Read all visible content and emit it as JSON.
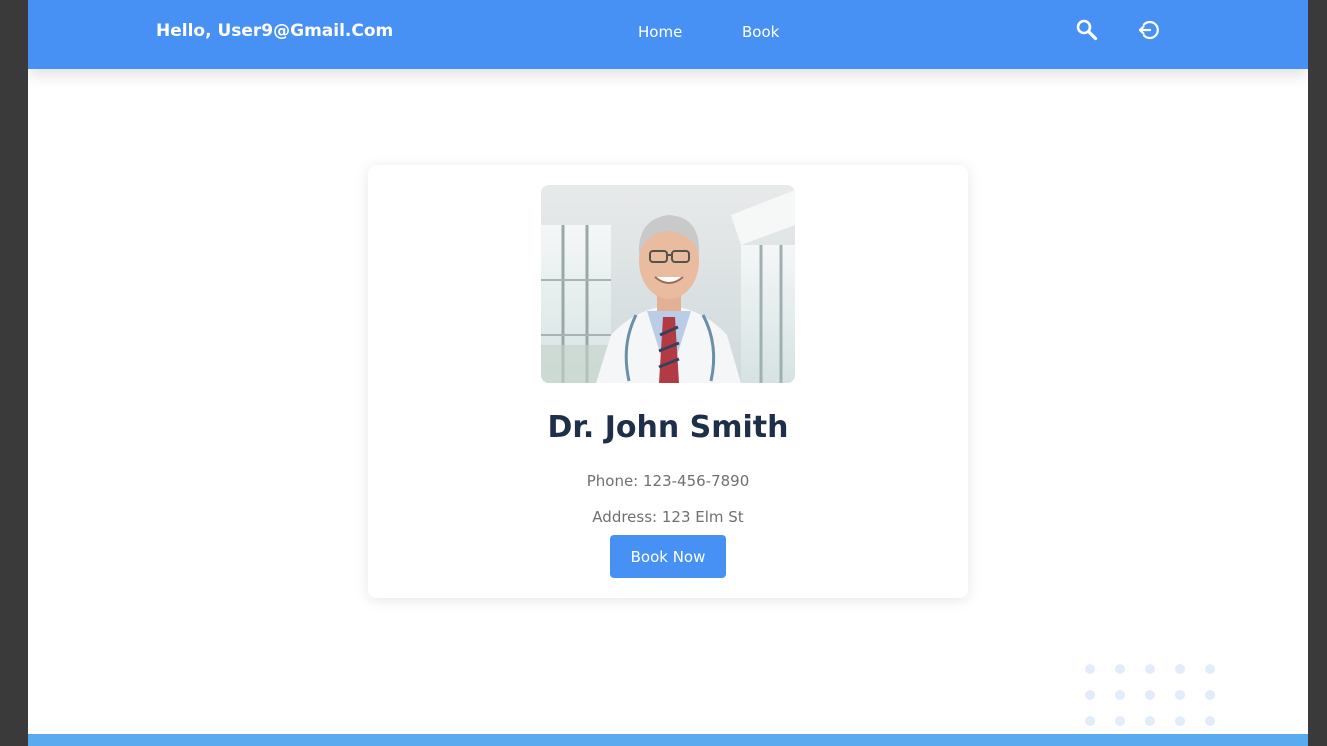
{
  "header": {
    "greeting": "Hello, User9@Gmail.Com",
    "nav": {
      "home_label": "Home",
      "book_label": "Book"
    },
    "icons": {
      "search": "search-icon",
      "logout": "logout-icon"
    }
  },
  "doctor": {
    "name": "Dr. John Smith",
    "phone": "Phone: 123-456-7890",
    "address": "Address: 123 Elm St",
    "photo_alt": "Dr. John Smith",
    "book_label": "Book Now"
  },
  "colors": {
    "primary": "#4791f5",
    "name_text": "#1e3049",
    "info_text": "#707070",
    "footer": "#5aaaf0",
    "dots": "#e3ecfa"
  }
}
